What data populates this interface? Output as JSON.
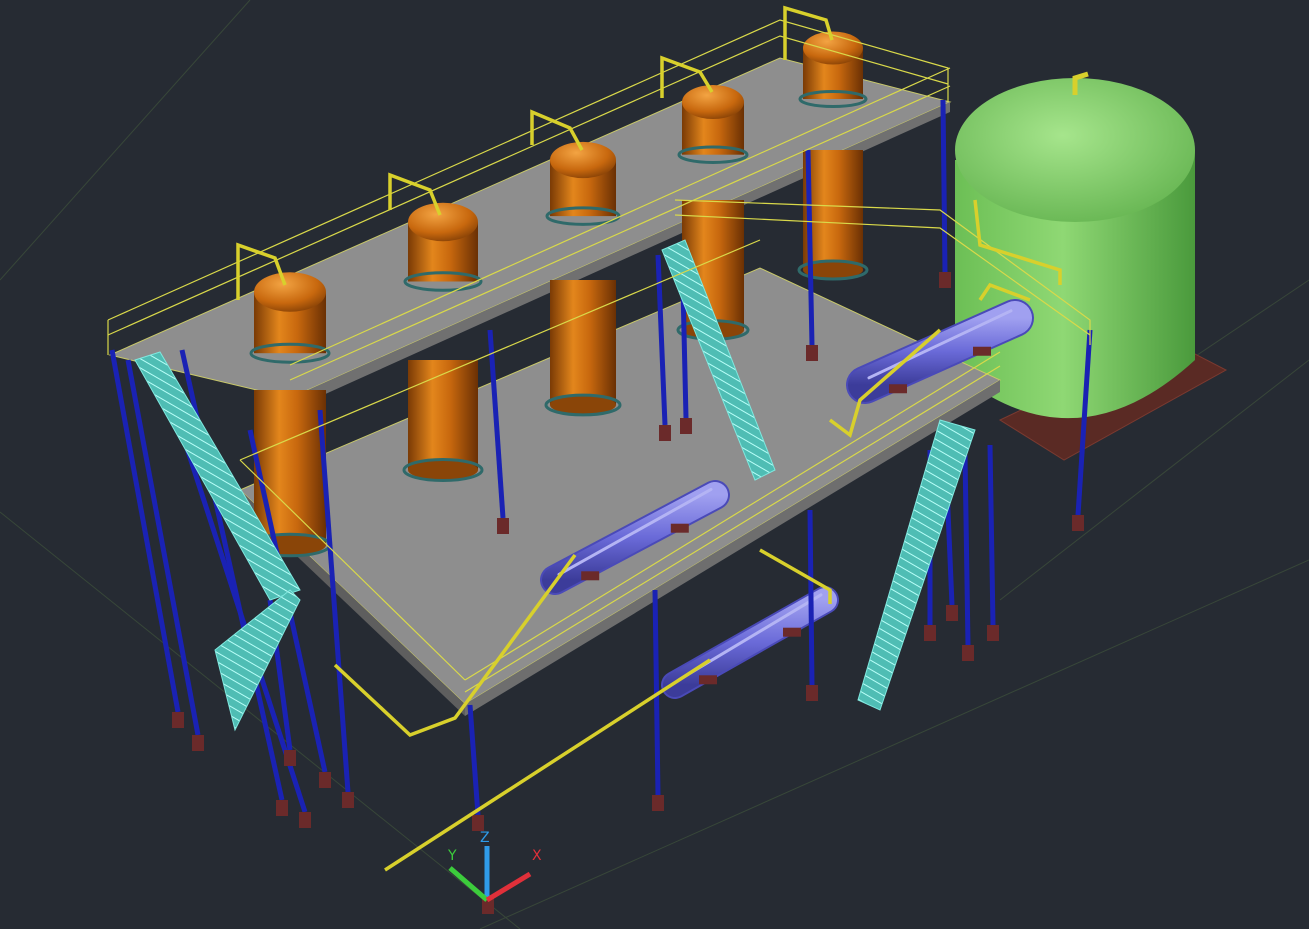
{
  "viewport": {
    "background": "#262b33",
    "hud_text": "",
    "visual_style": "shaded"
  },
  "ucs_icon": {
    "x_label": "X",
    "y_label": "Y",
    "z_label": "Z",
    "x_color": "#e0303a",
    "y_color": "#3ccc3c",
    "z_color": "#2f9be8"
  },
  "model": {
    "platform_color": "#8e8e8e",
    "railing_color": "#d9d94a",
    "column_color": "#1a22b4",
    "base_plate_color": "#6b2a2a",
    "stair_color": "#5fd0c8",
    "column_vessel_color": "#c8680e",
    "heat_exchanger_color": "#6a6ad8",
    "storage_tank_color": "#6cc15a",
    "tank_base_color": "#5a2a24",
    "pipe_color": "#d8d02c",
    "column_vessel_count": 5,
    "heat_exchanger_count": 3,
    "stair_count": 3
  }
}
